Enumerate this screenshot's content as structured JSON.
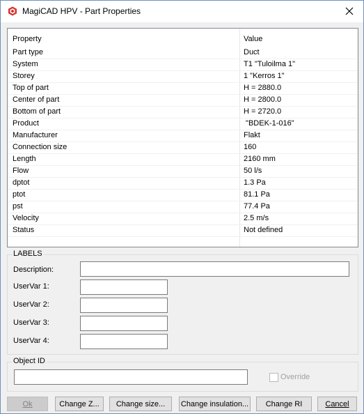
{
  "window": {
    "title": "MagiCAD HPV - Part Properties"
  },
  "table": {
    "headers": {
      "property": "Property",
      "value": "Value"
    },
    "rows": [
      {
        "property": "Part type",
        "value": "Duct"
      },
      {
        "property": "System",
        "value": "T1 \"Tuloilma 1\""
      },
      {
        "property": "Storey",
        "value": "1 \"Kerros 1\""
      },
      {
        "property": "Top of part",
        "value": "H = 2880.0"
      },
      {
        "property": "Center of part",
        "value": "H = 2800.0"
      },
      {
        "property": "Bottom of part",
        "value": "H = 2720.0"
      },
      {
        "property": "Product",
        "value": " \"BDEK-1-016\""
      },
      {
        "property": "Manufacturer",
        "value": "Flakt"
      },
      {
        "property": "Connection size",
        "value": "160"
      },
      {
        "property": "Length",
        "value": "2160 mm"
      },
      {
        "property": "Flow",
        "value": "50 l/s"
      },
      {
        "property": "dptot",
        "value": "1.3 Pa"
      },
      {
        "property": "ptot",
        "value": "81.1 Pa"
      },
      {
        "property": "pst",
        "value": "77.4 Pa"
      },
      {
        "property": "Velocity",
        "value": "2.5 m/s"
      },
      {
        "property": "Status",
        "value": "Not defined"
      }
    ]
  },
  "labels_group": {
    "title": "LABELS",
    "description_label": "Description:",
    "description_value": "",
    "uservar1_label": "UserVar 1:",
    "uservar1_value": "",
    "uservar2_label": "UserVar 2:",
    "uservar2_value": "",
    "uservar3_label": "UserVar 3:",
    "uservar3_value": "",
    "uservar4_label": "UserVar 4:",
    "uservar4_value": ""
  },
  "object_id_group": {
    "title": "Object ID",
    "value": "",
    "override_label": "Override",
    "override_checked": false
  },
  "buttons": {
    "ok": "Ok",
    "change_z": "Change Z...",
    "change_size": "Change size...",
    "change_insulation": "Change insulation...",
    "change_ri": "Change RI",
    "cancel": "Cancel"
  },
  "colors": {
    "accent": "#0078d7",
    "icon_red": "#d9302c"
  },
  "icons": {
    "app": "magicad-logo-icon",
    "close": "close-icon"
  }
}
